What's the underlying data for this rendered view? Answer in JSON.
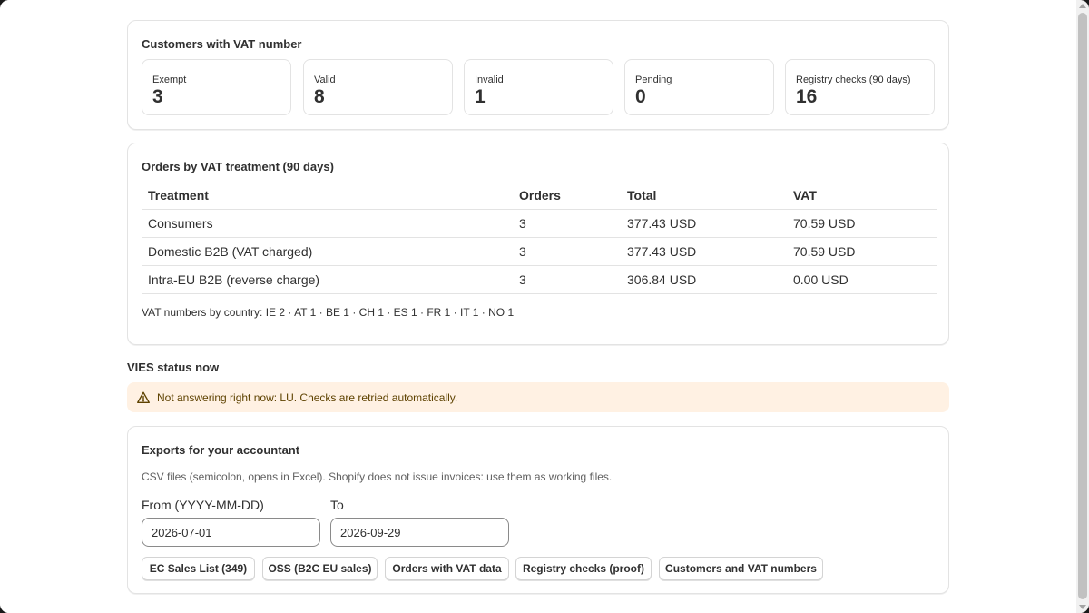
{
  "customers": {
    "title": "Customers with VAT number",
    "stats": [
      {
        "label": "Exempt",
        "value": "3"
      },
      {
        "label": "Valid",
        "value": "8"
      },
      {
        "label": "Invalid",
        "value": "1"
      },
      {
        "label": "Pending",
        "value": "0"
      },
      {
        "label": "Registry checks (90 days)",
        "value": "16"
      }
    ]
  },
  "orders": {
    "title": "Orders by VAT treatment (90 days)",
    "columns": [
      "Treatment",
      "Orders",
      "Total",
      "VAT"
    ],
    "rows": [
      [
        "Consumers",
        "3",
        "377.43 USD",
        "70.59 USD"
      ],
      [
        "Domestic B2B (VAT charged)",
        "3",
        "377.43 USD",
        "70.59 USD"
      ],
      [
        "Intra-EU B2B (reverse charge)",
        "3",
        "306.84 USD",
        "0.00 USD"
      ]
    ],
    "country_note": "VAT numbers by country: IE 2 · AT 1 · BE 1 · CH 1 · ES 1 · FR 1 · IT 1 · NO 1"
  },
  "vies": {
    "heading": "VIES status now",
    "banner_text": "Not answering right now: LU. Checks are retried automatically.",
    "banner_icon": "warning-icon"
  },
  "exports": {
    "title": "Exports for your accountant",
    "description": "CSV files (semicolon, opens in Excel). Shopify does not issue invoices: use them as working files.",
    "from_label": "From (YYYY-MM-DD)",
    "from_value": "2026-07-01",
    "to_label": "To",
    "to_value": "2026-09-29",
    "buttons": [
      "EC Sales List (349)",
      "OSS (B2C EU sales)",
      "Orders with VAT data",
      "Registry checks (proof)",
      "Customers and VAT numbers"
    ]
  },
  "colors": {
    "banner_bg": "#fff1e3",
    "banner_text": "#5e4200",
    "border": "#e3e3e3"
  }
}
